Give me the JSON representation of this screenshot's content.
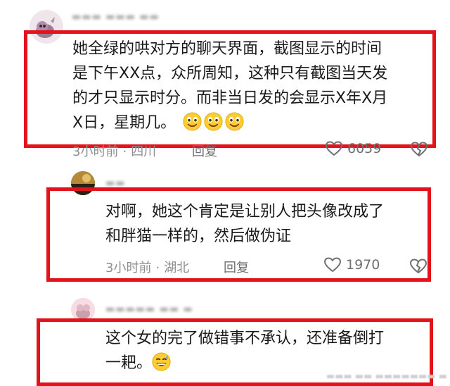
{
  "colors": {
    "highlight_border": "#e3121b",
    "meta_text": "#8e8e8e",
    "emoji_face": "#ffcc33"
  },
  "comments": [
    {
      "lines": [
        "她全绿的哄对方的聊天界面，截图显示的时间",
        "是下午XX点，众所周知，这种只有截图当天发",
        "的才只显示时分。而非当日发的会显示X年X月",
        "X日，星期几。"
      ],
      "emoji_names": [
        "smile-emoji",
        "smile-emoji",
        "smile-emoji"
      ],
      "time": "3小时前",
      "location": "四川",
      "reply": "回复",
      "likes": "6059"
    },
    {
      "lines": [
        "对啊，她这个肯定是让别人把头像改成了",
        "和胖猫一样的，然后做伪证"
      ],
      "time": "3小时前",
      "location": "湖北",
      "reply": "回复",
      "likes": "1970"
    },
    {
      "lines": [
        "这个女的完了做错事不承认，还准备倒打",
        "一耙。"
      ],
      "emoji_names": [
        "sweat-smile-emoji"
      ]
    }
  ]
}
